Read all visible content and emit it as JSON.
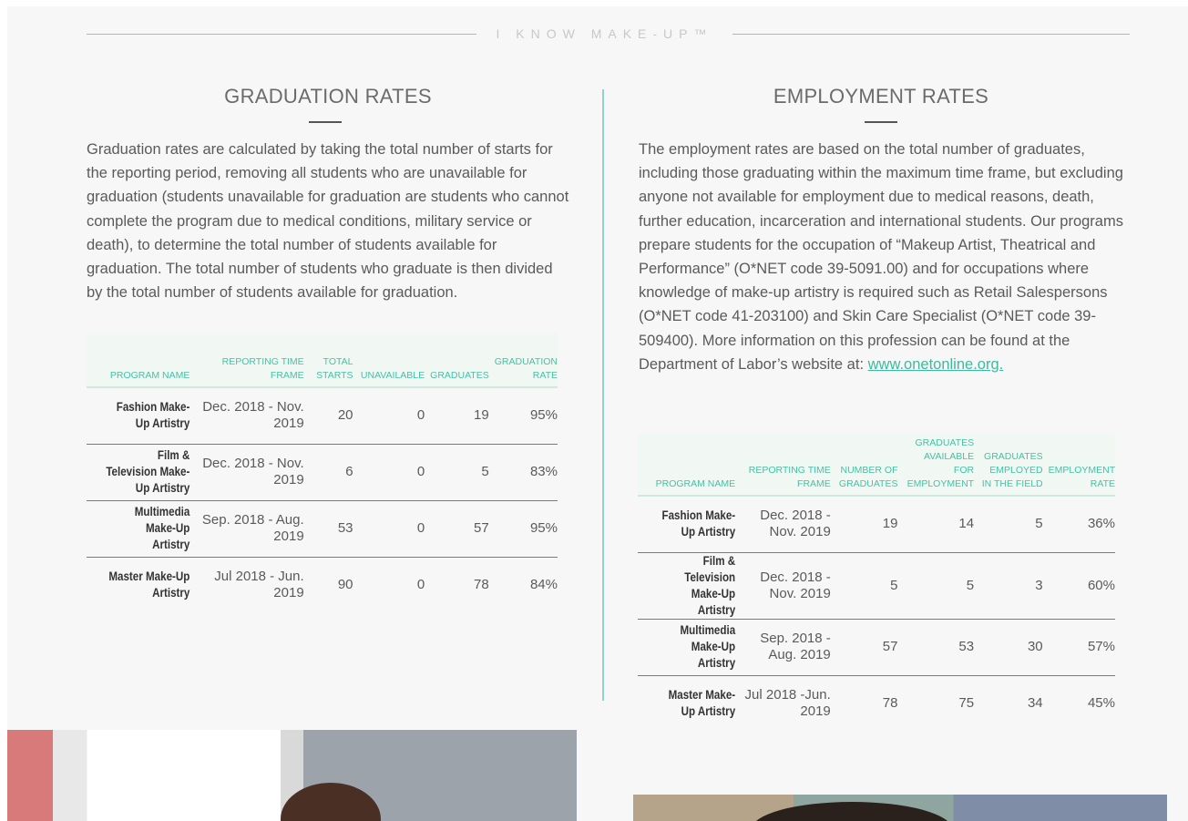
{
  "brand": "I KNOW MAKE-UP™",
  "graduation": {
    "title": "GRADUATION RATES",
    "paragraph": "Graduation rates are calculated by taking the total number of starts for the reporting period, removing all students who are unavailable for graduation (students unavailable for graduation are students who cannot complete the program due to medical conditions, military service or death), to determine the total number of students available for graduation. The total number of students who graduate is then divided by the total number of students available for graduation.",
    "table": {
      "headers": [
        "PROGRAM NAME",
        "REPORTING TIME FRAME",
        "TOTAL STARTS",
        "UNAVAILABLE",
        "GRADUATES",
        "GRADUATION RATE"
      ],
      "rows": [
        {
          "program": "Fashion Make-Up Artistry",
          "timeframe": "Dec. 2018 - Nov. 2019",
          "starts": "20",
          "unavailable": "0",
          "graduates": "19",
          "rate": "95%"
        },
        {
          "program": "Film & Television Make-Up Artistry",
          "timeframe": "Dec. 2018 - Nov. 2019",
          "starts": "6",
          "unavailable": "0",
          "graduates": "5",
          "rate": "83%"
        },
        {
          "program": "Multimedia Make-Up Artistry",
          "timeframe": "Sep. 2018 - Aug. 2019",
          "starts": "53",
          "unavailable": "0",
          "graduates": "57",
          "rate": "95%"
        },
        {
          "program": "Master Make-Up Artistry",
          "timeframe": "Jul 2018 - Jun. 2019",
          "starts": "90",
          "unavailable": "0",
          "graduates": "78",
          "rate": "84%"
        }
      ]
    }
  },
  "employment": {
    "title": "EMPLOYMENT RATES",
    "paragraph": "The employment rates are based on the total number of graduates, including those graduating within the maximum time frame, but excluding anyone not available for employment due to medical reasons, death, further education, incarceration and international students. Our programs prepare students for the occupation of “Makeup Artist, Theatrical and Performance” (O*NET code 39-5091.00) and for occupations where knowledge of make-up artistry is required such as Retail Salespersons (O*NET code 41-203100) and Skin Care Specialist (O*NET code 39-509400). More information on this profession can be found at the Department of Labor’s website at:",
    "link": "www.onetonline.org.",
    "table": {
      "headers": [
        "PROGRAM NAME",
        "REPORTING TIME FRAME",
        "NUMBER OF GRADUATES",
        "GRADUATES AVAILABLE FOR EMPLOYMENT",
        "GRADUATES EMPLOYED IN THE FIELD",
        "EMPLOYMENT RATE"
      ],
      "rows": [
        {
          "program": "Fashion Make-Up Artistry",
          "timeframe": "Dec. 2018 -Nov. 2019",
          "graduates": "19",
          "available": "14",
          "employed": "5",
          "rate": "36%"
        },
        {
          "program": "Film & Television Make-Up Artistry",
          "timeframe": "Dec. 2018 -Nov. 2019",
          "graduates": "5",
          "available": "5",
          "employed": "3",
          "rate": "60%"
        },
        {
          "program": "Multimedia Make-Up Artistry",
          "timeframe": "Sep. 2018 -Aug. 2019",
          "graduates": "57",
          "available": "53",
          "employed": "30",
          "rate": "57%"
        },
        {
          "program": "Master Make-Up Artistry",
          "timeframe": "Jul 2018 -Jun. 2019",
          "graduates": "78",
          "available": "75",
          "employed": "34",
          "rate": "45%"
        }
      ]
    }
  },
  "colors": {
    "accent": "#45c2a5",
    "rule": "#7ccfbd",
    "text": "#5a5a5a"
  }
}
